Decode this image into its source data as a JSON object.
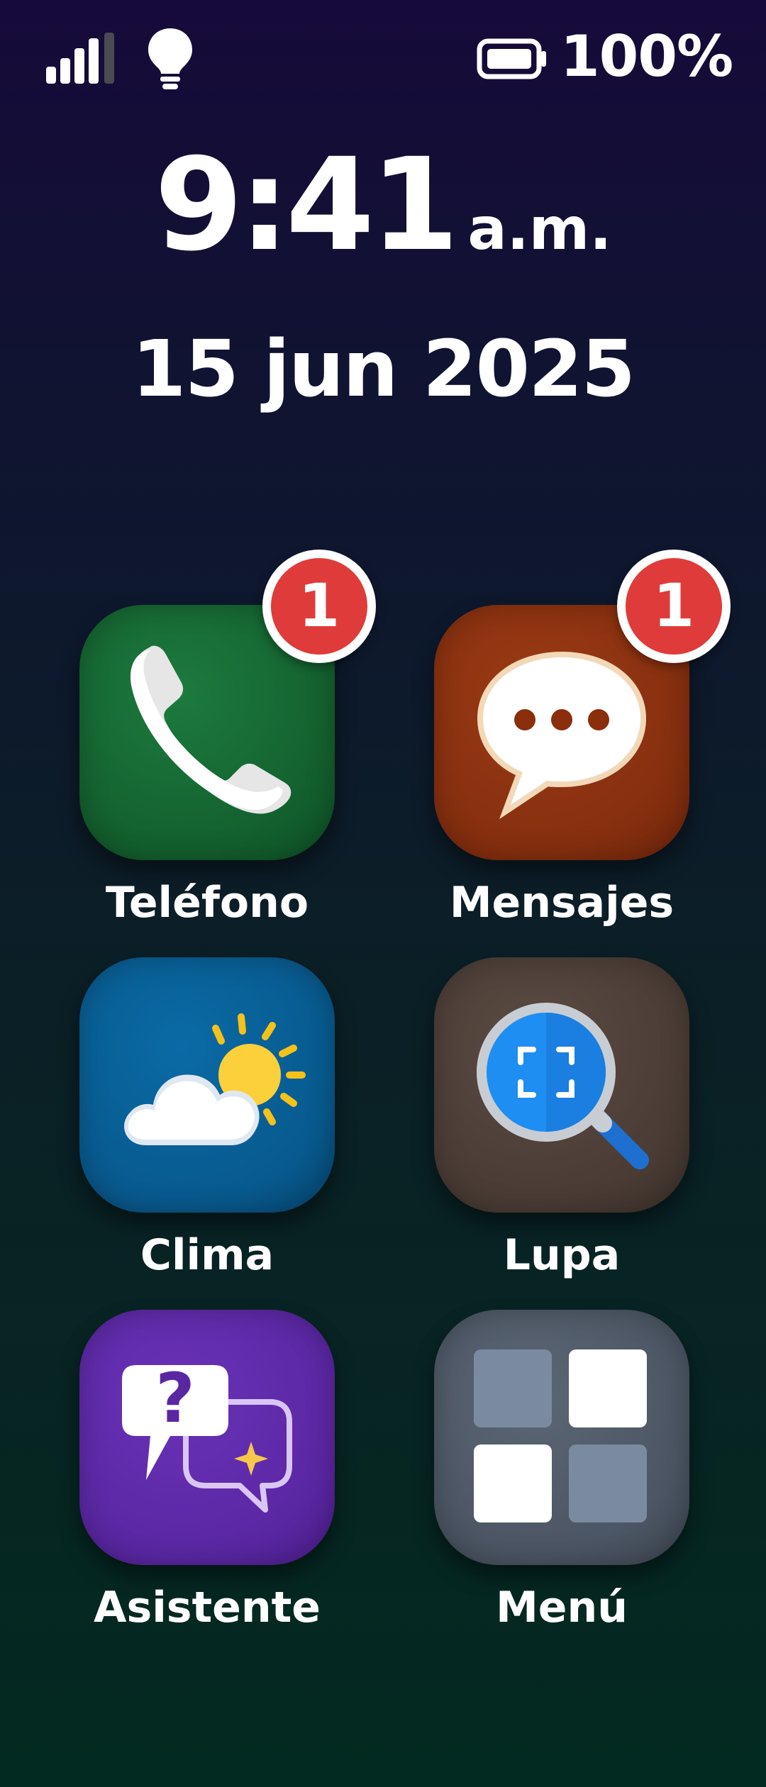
{
  "status_bar": {
    "signal_icon": "signal-bars-icon",
    "light_icon": "lightbulb-icon",
    "battery_icon": "battery-full-icon",
    "battery_text": "100%"
  },
  "clock": {
    "time": "9:41",
    "ampm": "a.m.",
    "date": "15 jun 2025"
  },
  "apps": [
    {
      "label": "Teléfono",
      "icon": "phone-icon",
      "badge": "1",
      "color": "#13602e"
    },
    {
      "label": "Mensajes",
      "icon": "chat-bubble-icon",
      "badge": "1",
      "color": "#862f0f"
    },
    {
      "label": "Clima",
      "icon": "cloud-sun-icon",
      "color": "#085a8e"
    },
    {
      "label": "Lupa",
      "icon": "magnifier-icon",
      "color": "#4a3c35"
    },
    {
      "label": "Asistente",
      "icon": "assistant-chat-icon",
      "color": "#5a27a3"
    },
    {
      "label": "Menú",
      "icon": "grid-menu-icon",
      "color": "#4b5563"
    }
  ],
  "colors": {
    "badge": "#e03b3b",
    "background_top": "#160a3a",
    "background_bottom": "#032a20"
  }
}
